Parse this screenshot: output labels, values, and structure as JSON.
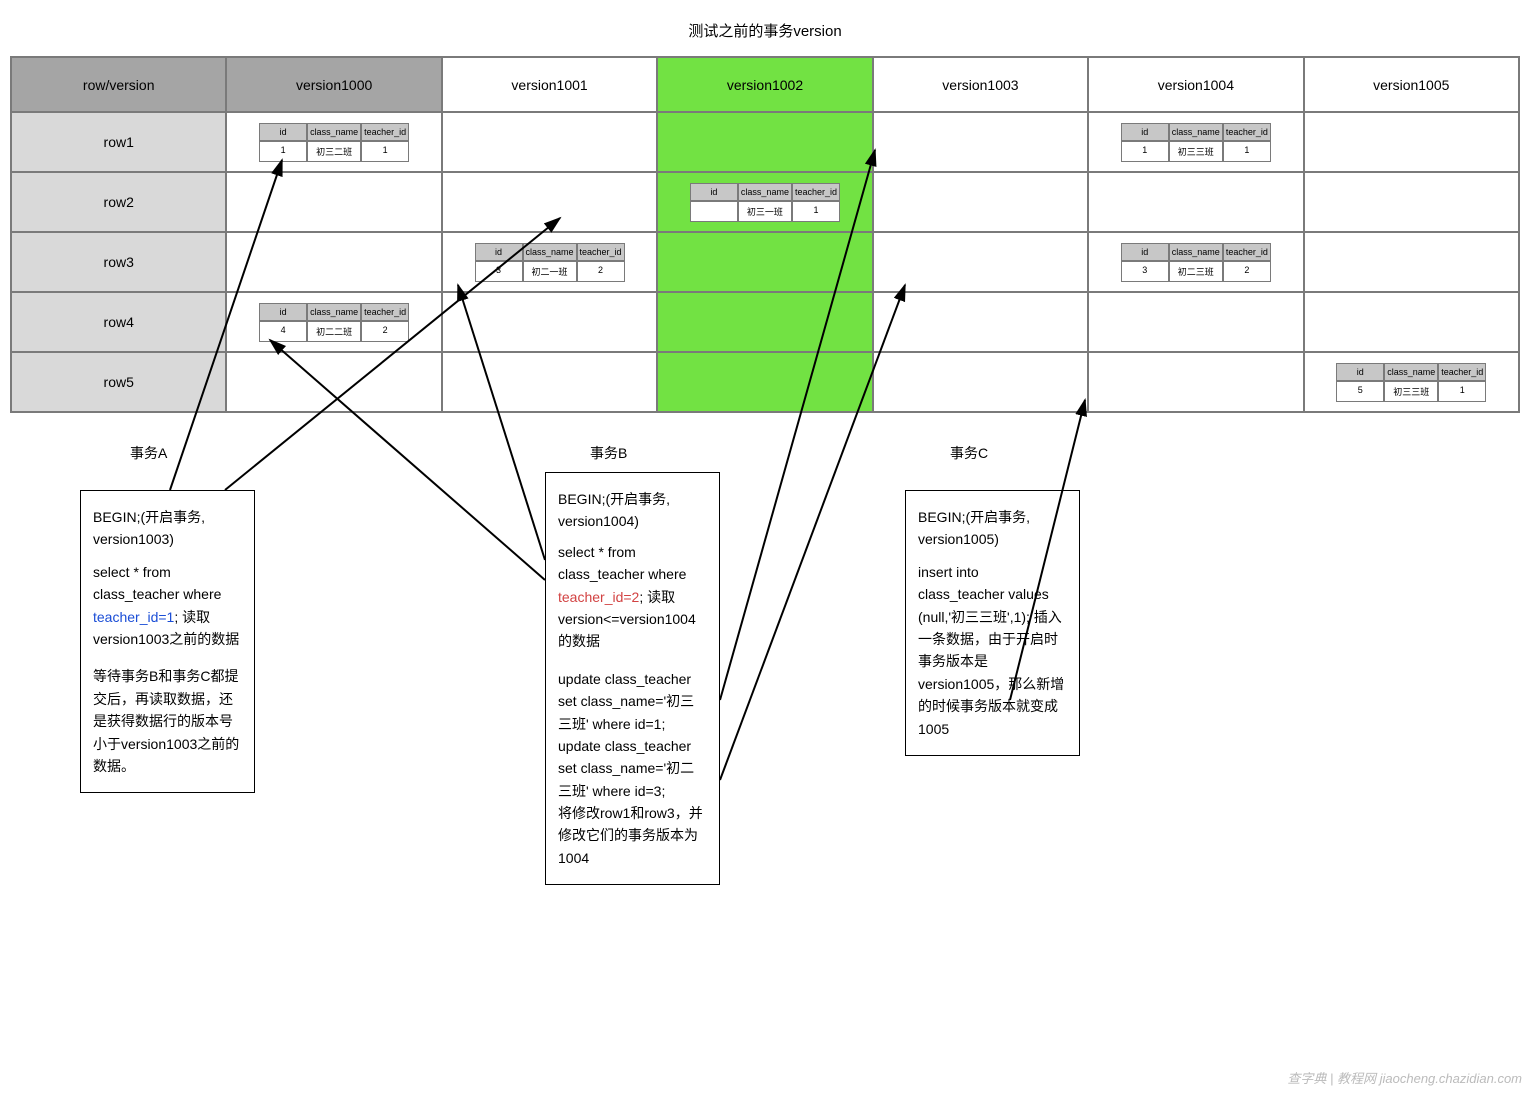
{
  "title": "测试之前的事务version",
  "headers": [
    "row/version",
    "version1000",
    "version1001",
    "version1002",
    "version1003",
    "version1004",
    "version1005"
  ],
  "rows": [
    "row1",
    "row2",
    "row3",
    "row4",
    "row5"
  ],
  "mini_head": {
    "c1": "id",
    "c2": "class_name",
    "c3": "teacher_id"
  },
  "cells": {
    "r1v1000": {
      "id": "1",
      "name": "初三二班",
      "tid": "1"
    },
    "r2v1002": {
      "id": "",
      "name": "初三一班",
      "tid": "1"
    },
    "r3v1001": {
      "id": "3",
      "name": "初二一班",
      "tid": "2"
    },
    "r4v1000": {
      "id": "4",
      "name": "初二二班",
      "tid": "2"
    },
    "r1v1004": {
      "id": "1",
      "name": "初三三班",
      "tid": "1"
    },
    "r3v1004": {
      "id": "3",
      "name": "初二三班",
      "tid": "2"
    },
    "r5v1005": {
      "id": "5",
      "name": "初三三班",
      "tid": "1"
    }
  },
  "txA": {
    "label": "事务A",
    "t1": "BEGIN;(开启事务, version1003)",
    "t2": "select * from class_teacher where ",
    "t3": "teacher_id=1",
    "t4": "; 读取version1003之前的数据",
    "t5": "等待事务B和事务C都提交后，再读取数据，还是获得数据行的版本号小于version1003之前的数据。"
  },
  "txB": {
    "label": "事务B",
    "t1": "BEGIN;(开启事务, version1004)",
    "t2": "select * from class_teacher where ",
    "t3": "teacher_id=2",
    "t4": "; 读取version<=version1004的数据",
    "t5": "update class_teacher set class_name='初三三班' where id=1; update class_teacher set class_name='初二三班' where id=3;",
    "t6": "将修改row1和row3，并修改它们的事务版本为1004"
  },
  "txC": {
    "label": "事务C",
    "t1": "BEGIN;(开启事务, version1005)",
    "t2": "insert into class_teacher values (null,'初三三班',1); 插入一条数据，由于开启时事务版本是version1005，那么新增的时候事务版本就变成1005"
  },
  "watermark": "查字典 | 教程网  jiaocheng.chazidian.com"
}
